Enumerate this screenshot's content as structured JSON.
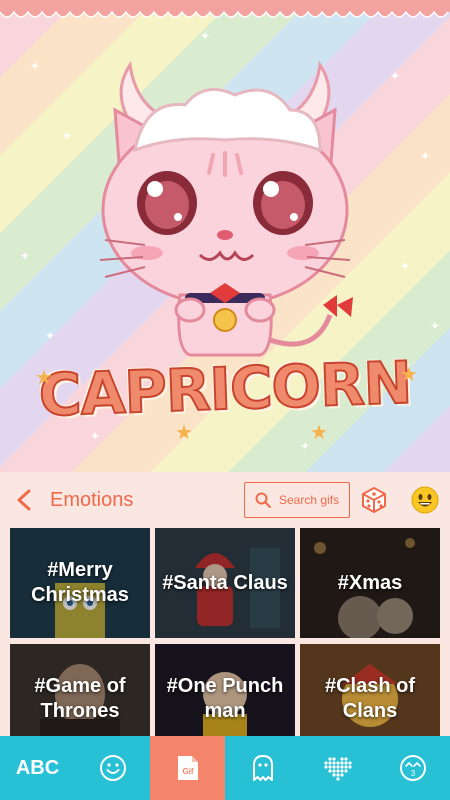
{
  "theme": {
    "banner_text": "CAPRICORN"
  },
  "header": {
    "back_icon": "chevron-left-icon",
    "title": "Emotions",
    "search_placeholder": "Search gifs",
    "dice_icon": "dice-icon",
    "emoji_icon": "smiley-emoji-icon"
  },
  "gifs": [
    {
      "label": "#Merry Christmas"
    },
    {
      "label": "#Santa Claus"
    },
    {
      "label": "#Xmas"
    },
    {
      "label": "#Game of Thrones"
    },
    {
      "label": "#One Punch man"
    },
    {
      "label": "#Clash of Clans"
    }
  ],
  "bottom_bar": {
    "tabs": [
      {
        "label": "ABC",
        "icon": "abc-text"
      },
      {
        "label": "",
        "icon": "smiley-icon"
      },
      {
        "label": "Gif",
        "icon": "gif-icon"
      },
      {
        "label": "",
        "icon": "ghost-icon"
      },
      {
        "label": "",
        "icon": "heart-dots-icon"
      },
      {
        "label": "3",
        "icon": "emoticon-3-icon"
      }
    ],
    "active_tab": 2
  },
  "colors": {
    "accent": "#f06a4a",
    "bar": "#28c0d4",
    "active_tab": "#f5856a"
  }
}
